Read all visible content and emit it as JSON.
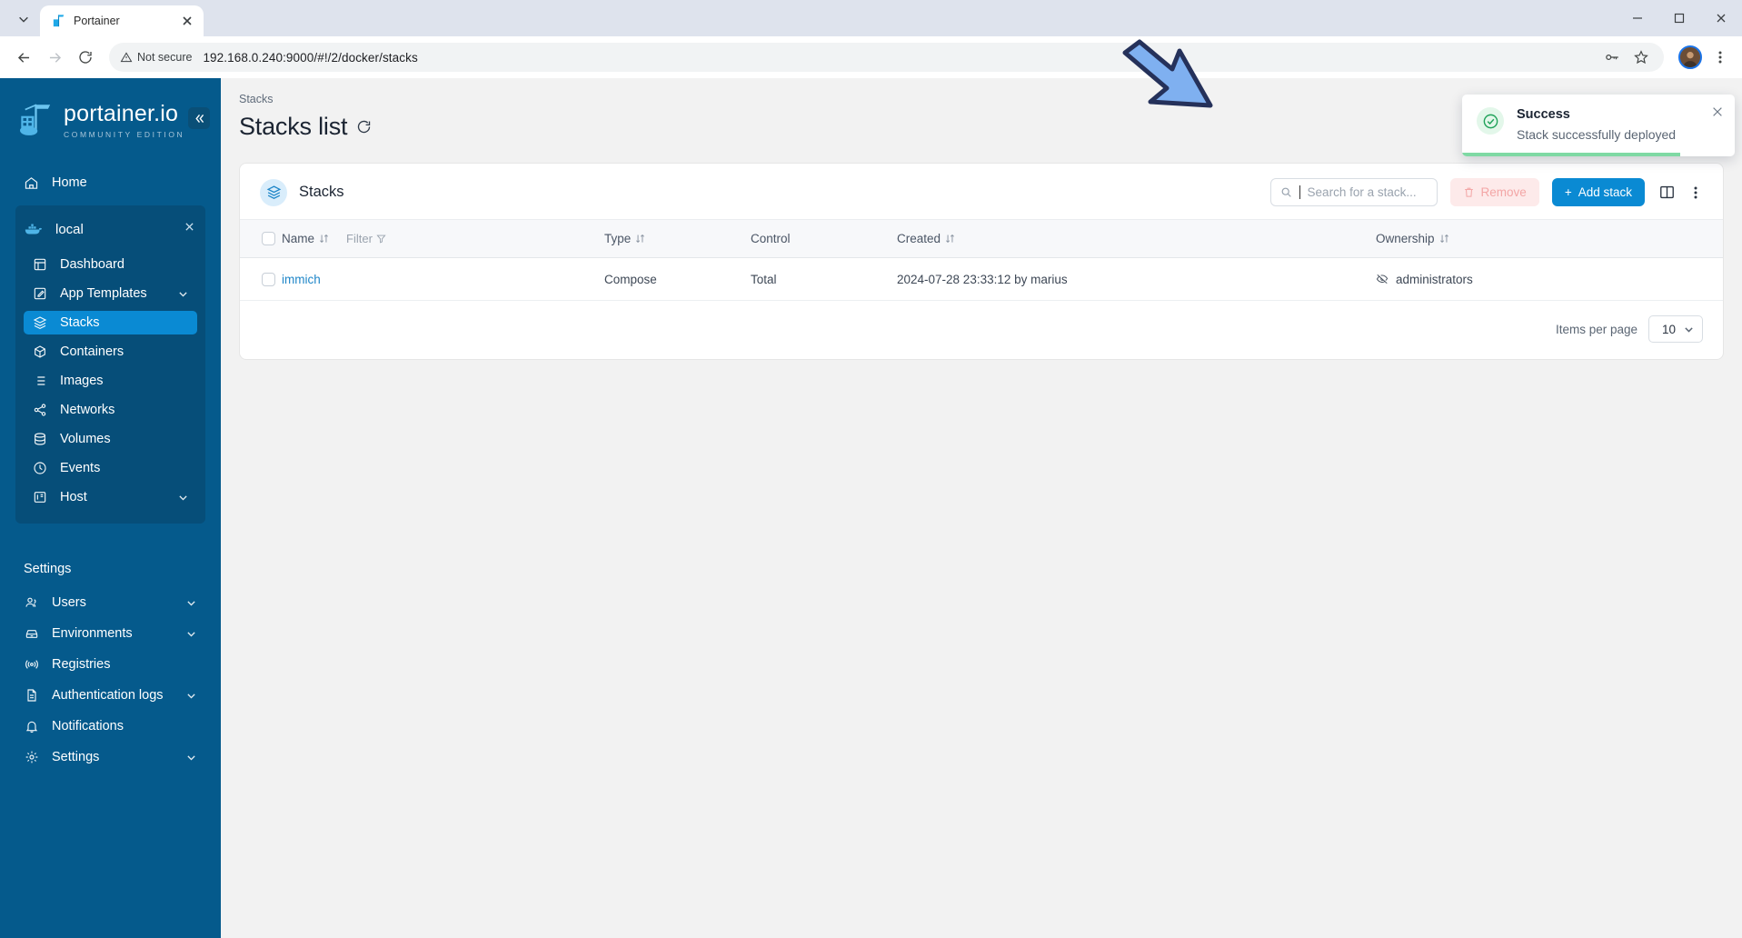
{
  "browser": {
    "tab": {
      "title": "Portainer",
      "favicon_icon": "portainer-favicon"
    },
    "tab_list_icon": "chevron-down-icon",
    "back_icon": "arrow-left-icon",
    "forward_icon": "arrow-right-icon",
    "reload_icon": "reload-icon",
    "security_label": "Not secure",
    "security_icon": "warning-triangle-icon",
    "url": "192.168.0.240:9000/#!/2/docker/stacks",
    "password_icon": "key-icon",
    "bookmark_icon": "star-icon",
    "profile_icon": "avatar-icon",
    "menu_icon": "kebab-menu-icon",
    "minimize_icon": "minimize-icon",
    "maximize_icon": "maximize-icon",
    "close_icon": "window-close-icon"
  },
  "sidebar": {
    "logo": {
      "name": "portainer.io",
      "subtitle": "COMMUNITY EDITION",
      "icon": "portainer-logo-icon"
    },
    "collapse_icon": "double-chevron-left-icon",
    "home": {
      "label": "Home",
      "icon": "home-icon"
    },
    "environment": {
      "name": "local",
      "icon": "docker-whale-icon",
      "close_icon": "close-icon",
      "items": [
        {
          "label": "Dashboard",
          "icon": "dashboard-icon",
          "active": false,
          "expandable": false
        },
        {
          "label": "App Templates",
          "icon": "template-icon",
          "active": false,
          "expandable": true
        },
        {
          "label": "Stacks",
          "icon": "stacks-icon",
          "active": true,
          "expandable": false
        },
        {
          "label": "Containers",
          "icon": "container-icon",
          "active": false,
          "expandable": false
        },
        {
          "label": "Images",
          "icon": "images-icon",
          "active": false,
          "expandable": false
        },
        {
          "label": "Networks",
          "icon": "networks-icon",
          "active": false,
          "expandable": false
        },
        {
          "label": "Volumes",
          "icon": "volumes-icon",
          "active": false,
          "expandable": false
        },
        {
          "label": "Events",
          "icon": "events-icon",
          "active": false,
          "expandable": false
        },
        {
          "label": "Host",
          "icon": "host-icon",
          "active": false,
          "expandable": true
        }
      ]
    },
    "settings_label": "Settings",
    "settings_items": [
      {
        "label": "Users",
        "icon": "users-icon",
        "expandable": true
      },
      {
        "label": "Environments",
        "icon": "environments-icon",
        "expandable": true
      },
      {
        "label": "Registries",
        "icon": "registries-icon",
        "expandable": false
      },
      {
        "label": "Authentication logs",
        "icon": "document-icon",
        "expandable": true
      },
      {
        "label": "Notifications",
        "icon": "bell-icon",
        "expandable": false
      },
      {
        "label": "Settings",
        "icon": "gear-icon",
        "expandable": true
      }
    ]
  },
  "main": {
    "breadcrumb": "Stacks",
    "page_title": "Stacks list",
    "refresh_icon": "refresh-icon",
    "card": {
      "title": "Stacks",
      "icon": "stacks-icon",
      "search_placeholder": "Search for a stack...",
      "search_value": "",
      "search_icon": "search-icon",
      "remove_label": "Remove",
      "remove_icon": "trash-icon",
      "add_label": "Add stack",
      "add_prefix": "+",
      "columns_icon": "columns-layout-icon",
      "more_icon": "kebab-menu-icon"
    },
    "table": {
      "select_all_icon": "checkbox-icon",
      "filter_label": "Filter",
      "filter_icon": "funnel-icon",
      "sort_icon": "sort-arrows-icon",
      "columns": [
        {
          "label": "Name",
          "sortable": true
        },
        {
          "label": "Type",
          "sortable": true
        },
        {
          "label": "Control",
          "sortable": false
        },
        {
          "label": "Created",
          "sortable": true
        },
        {
          "label": "Ownership",
          "sortable": true
        }
      ],
      "rows": [
        {
          "name": "immich",
          "type": "Compose",
          "control": "Total",
          "created": "2024-07-28 23:33:12 by marius",
          "ownership": "administrators",
          "ownership_icon": "eye-off-icon"
        }
      ]
    },
    "pagination": {
      "label": "Items per page",
      "value": "10",
      "chevron_icon": "chevron-down-icon"
    }
  },
  "toast": {
    "title": "Success",
    "message": "Stack successfully deployed",
    "icon": "check-circle-icon",
    "close_icon": "close-icon",
    "accent_color": "#21a35a"
  },
  "annotation": {
    "arrow_icon": "arrow-down-right-icon",
    "fill_color": "#7fb0f0",
    "stroke_color": "#25315a"
  }
}
